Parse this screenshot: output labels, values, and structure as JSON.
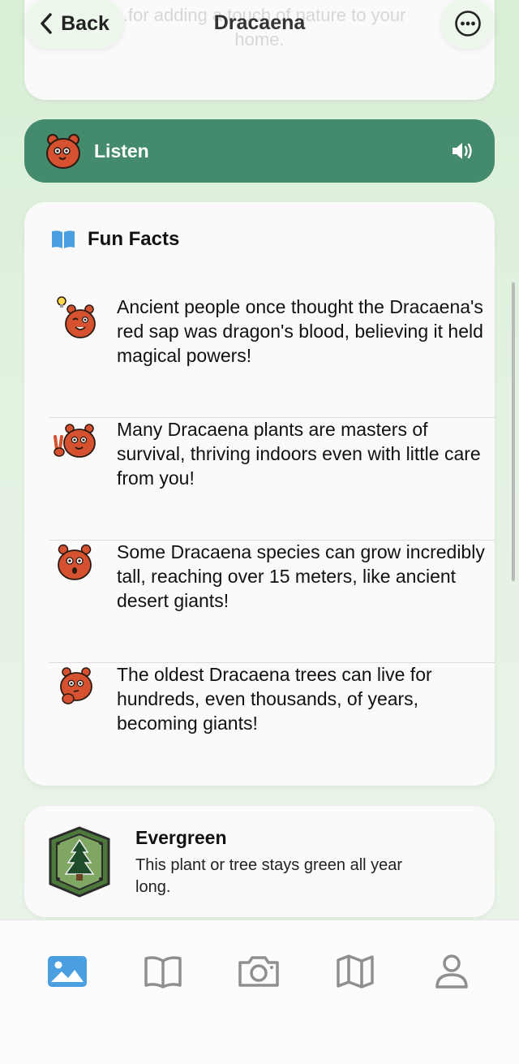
{
  "header": {
    "back_label": "Back",
    "title": "Dracaena",
    "faded_text_line1": "...for adding a touch of nature to your",
    "faded_text_line2": "home."
  },
  "listen": {
    "label": "Listen"
  },
  "fun_facts": {
    "heading": "Fun Facts",
    "items": [
      {
        "mascot": "bear-lightbulb-icon",
        "text": "Ancient people once thought the Dracaena's red sap was dragon's blood, believing it held magical powers!"
      },
      {
        "mascot": "bear-peace-sign-icon",
        "text": "Many Dracaena plants are masters of survival, thriving indoors even with little care from you!"
      },
      {
        "mascot": "bear-surprised-icon",
        "text": "Some Dracaena species can grow incredibly tall, reaching over 15 meters, like ancient desert giants!"
      },
      {
        "mascot": "bear-thinking-icon",
        "text": "The oldest Dracaena trees can live for hundreds, even thousands, of years, becoming giants!"
      }
    ]
  },
  "evergreen": {
    "title": "Evergreen",
    "description": "This plant or tree stays green all year long.",
    "icon": "evergreen-badge-icon"
  },
  "tabbar": {
    "items": [
      {
        "icon": "photo-icon",
        "active": true
      },
      {
        "icon": "book-icon",
        "active": false
      },
      {
        "icon": "camera-icon",
        "active": false
      },
      {
        "icon": "map-icon",
        "active": false
      },
      {
        "icon": "profile-icon",
        "active": false
      }
    ]
  },
  "colors": {
    "listen_bg": "#448a6c",
    "accent_blue": "#4a9fe0",
    "bear": "#d5512f",
    "inactive_icon": "#8f8f8f"
  }
}
